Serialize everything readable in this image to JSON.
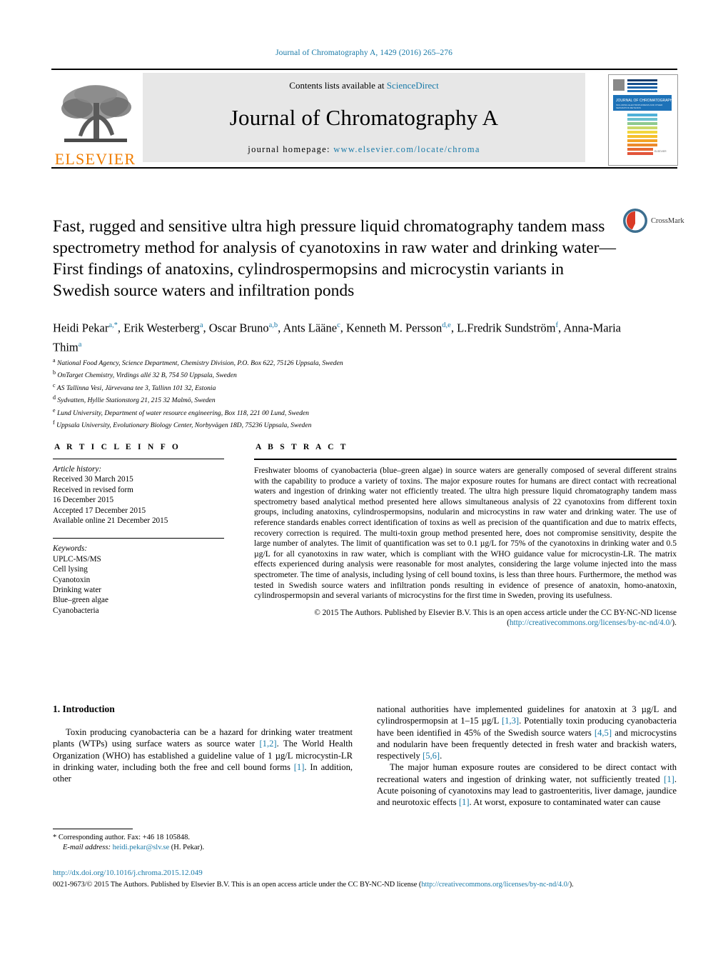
{
  "running_head": "Journal of Chromatography A, 1429 (2016) 265–276",
  "masthead": {
    "publisher_logo_name": "ELSEVIER",
    "contents_prefix": "Contents lists available at ",
    "contents_link": "ScienceDirect",
    "journal_title": "Journal of Chromatography A",
    "homepage_prefix": "journal homepage: ",
    "homepage_url": "www.elsevier.com/locate/chroma",
    "cover_title": "JOURNAL OF CHROMATOGRAPHY A",
    "cover_subtitle": "INCLUDING ELECTROPHORESIS AND OTHER SEPARATION METHODS"
  },
  "article": {
    "title": "Fast, rugged and sensitive ultra high pressure liquid chromatography tandem mass spectrometry method for analysis of cyanotoxins in raw water and drinking water—First findings of anatoxins, cylindrospermopsins and microcystin variants in Swedish source waters and infiltration ponds",
    "crossmark_label": "CrossMark",
    "authors": [
      {
        "name": "Heidi Pekar",
        "marks": "a,*"
      },
      {
        "name": "Erik Westerberg",
        "marks": "a"
      },
      {
        "name": "Oscar Bruno",
        "marks": "a,b"
      },
      {
        "name": "Ants Lääne",
        "marks": "c"
      },
      {
        "name": "Kenneth M. Persson",
        "marks": "d,e"
      },
      {
        "name": "L.Fredrik Sundström",
        "marks": "f"
      },
      {
        "name": "Anna-Maria Thim",
        "marks": "a"
      }
    ],
    "affiliations": [
      {
        "mark": "a",
        "text": "National Food Agency, Science Department, Chemistry Division, P.O. Box 622, 75126 Uppsala, Sweden"
      },
      {
        "mark": "b",
        "text": "OnTarget Chemistry, Virdings allé 32 B, 754 50 Uppsala, Sweden"
      },
      {
        "mark": "c",
        "text": "AS Tallinna Vesi, Järvevana tee 3, Tallinn 101 32, Estonia"
      },
      {
        "mark": "d",
        "text": "Sydvatten, Hyllie Stationstorg 21, 215 32 Malmö, Sweden"
      },
      {
        "mark": "e",
        "text": "Lund University, Department of water resource engineering, Box 118, 221 00 Lund, Sweden"
      },
      {
        "mark": "f",
        "text": "Uppsala University, Evolutionary Biology Center, Norbyvägen 18D, 75236 Uppsala, Sweden"
      }
    ]
  },
  "article_info": {
    "heading": "A R T I C L E   I N F O",
    "history_label": "Article history:",
    "history": [
      "Received 30 March 2015",
      "Received in revised form",
      "16 December 2015",
      "Accepted 17 December 2015",
      "Available online 21 December 2015"
    ],
    "keywords_label": "Keywords:",
    "keywords": [
      "UPLC-MS/MS",
      "Cell lysing",
      "Cyanotoxin",
      "Drinking water",
      "Blue–green algae",
      "Cyanobacteria"
    ]
  },
  "abstract": {
    "heading": "A B S T R A C T",
    "text": "Freshwater blooms of cyanobacteria (blue–green algae) in source waters are generally composed of several different strains with the capability to produce a variety of toxins. The major exposure routes for humans are direct contact with recreational waters and ingestion of drinking water not efficiently treated. The ultra high pressure liquid chromatography tandem mass spectrometry based analytical method presented here allows simultaneous analysis of 22 cyanotoxins from different toxin groups, including anatoxins, cylindrospermopsins, nodularin and microcystins in raw water and drinking water. The use of reference standards enables correct identification of toxins as well as precision of the quantification and due to matrix effects, recovery correction is required. The multi-toxin group method presented here, does not compromise sensitivity, despite the large number of analytes. The limit of quantification was set to 0.1 µg/L for 75% of the cyanotoxins in drinking water and 0.5 µg/L for all cyanotoxins in raw water, which is compliant with the WHO guidance value for microcystin-LR. The matrix effects experienced during analysis were reasonable for most analytes, considering the large volume injected into the mass spectrometer. The time of analysis, including lysing of cell bound toxins, is less than three hours. Furthermore, the method was tested in Swedish source waters and infiltration ponds resulting in evidence of presence of anatoxin, homo-anatoxin, cylindrospermopsin and several variants of microcystins for the first time in Sweden, proving its usefulness.",
    "copyright_pre": "© 2015 The Authors. Published by Elsevier B.V. This is an open access article under the CC BY-NC-ND license (",
    "copyright_link": "http://creativecommons.org/licenses/by-nc-nd/4.0/",
    "copyright_post": ")."
  },
  "body": {
    "section_heading": "1. Introduction",
    "left_paragraph_1_a": "Toxin producing cyanobacteria can be a hazard for drinking water treatment plants (WTPs) using surface waters as source water ",
    "left_ref_1": "[1,2]",
    "left_paragraph_1_b": ". The World Health Organization (WHO) has established a guideline value of 1 µg/L microcystin-LR in drinking water, including both the free and cell bound forms ",
    "left_ref_2": "[1]",
    "left_paragraph_1_c": ". In addition, other",
    "right_paragraph_1_a": "national authorities have implemented guidelines for anatoxin at 3 µg/L and cylindrospermopsin at 1–15 µg/L ",
    "right_ref_1": "[1,3]",
    "right_paragraph_1_b": ". Potentially toxin producing cyanobacteria have been identified in 45% of the Swedish source waters ",
    "right_ref_2": "[4,5]",
    "right_paragraph_1_c": " and microcystins and nodularin have been frequently detected in fresh water and brackish waters, respectively ",
    "right_ref_3": "[5,6]",
    "right_paragraph_1_d": ".",
    "right_paragraph_2_a": "The major human exposure routes are considered to be direct contact with recreational waters and ingestion of drinking water, not sufficiently treated ",
    "right_ref_4": "[1]",
    "right_paragraph_2_b": ". Acute poisoning of cyanotoxins may lead to gastroenteritis, liver damage, jaundice and neurotoxic effects ",
    "right_ref_5": "[1]",
    "right_paragraph_2_c": ". At worst, exposure to contaminated water can cause"
  },
  "footnote": {
    "star": "*",
    "corresponding": "Corresponding author. Fax: +46 18 105848.",
    "email_label": "E-mail address:",
    "email": "heidi.pekar@slv.se",
    "email_suffix": "(H. Pekar)."
  },
  "footer": {
    "doi": "http://dx.doi.org/10.1016/j.chroma.2015.12.049",
    "license_pre": "0021-9673/© 2015 The Authors. Published by Elsevier B.V. This is an open access article under the CC BY-NC-ND license (",
    "license_link": "http://creativecommons.org/licenses/by-nc-nd/4.0/",
    "license_post": ")."
  },
  "colors": {
    "link": "#1a7aa8",
    "elsevier_orange": "#f07d00",
    "band_gray": "#e7e7e7"
  }
}
